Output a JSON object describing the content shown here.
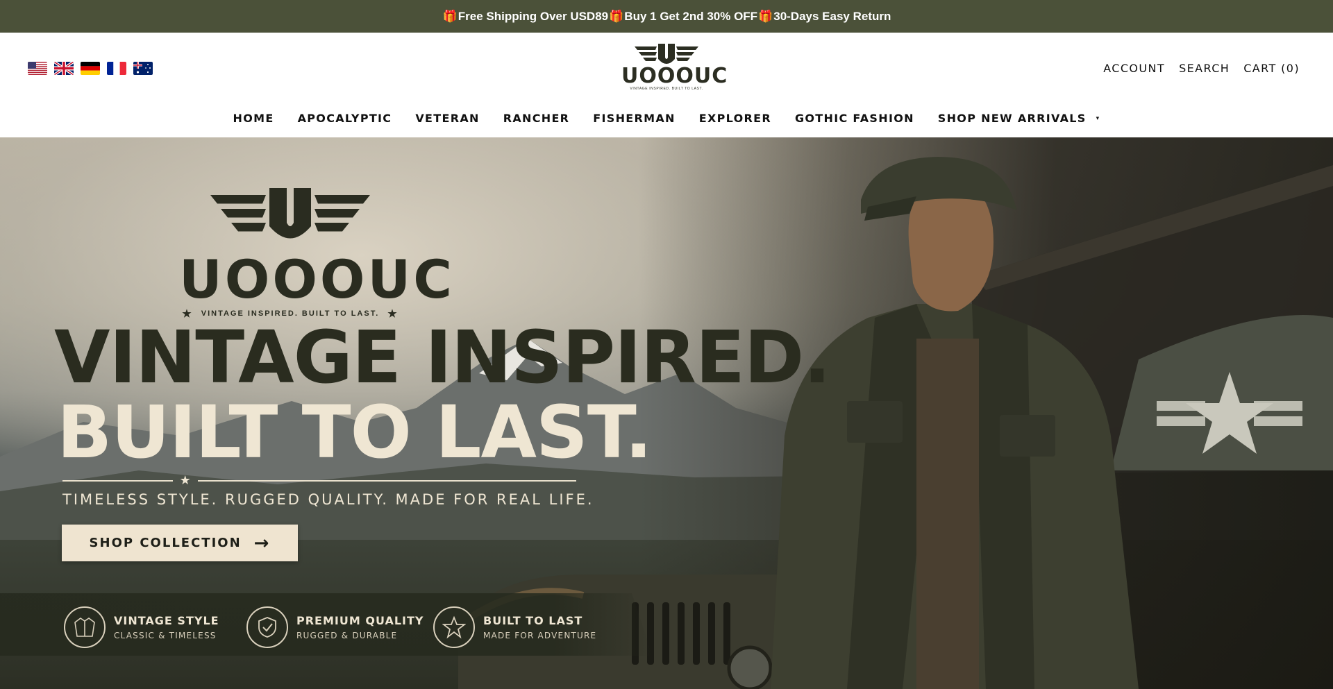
{
  "announcement": {
    "part1": "Free Shipping Over USD89",
    "part2": "Buy 1 Get 2nd 30% OFF",
    "part3": "30-Days Easy Return",
    "gift_glyph": "🎁"
  },
  "header": {
    "flags": [
      "us-flag-icon",
      "uk-flag-icon",
      "germany-flag-icon",
      "france-flag-icon",
      "australia-flag-icon"
    ],
    "logo": {
      "word": "UOOOUC",
      "tagline": "VINTAGE INSPIRED. BUILT TO LAST."
    },
    "account": "ACCOUNT",
    "search": "SEARCH",
    "cart": "CART (0)"
  },
  "nav": {
    "items": [
      "HOME",
      "APOCALYPTIC",
      "VETERAN",
      "RANCHER",
      "FISHERMAN",
      "EXPLORER",
      "GOTHIC FASHION",
      "SHOP NEW ARRIVALS"
    ],
    "caret_glyph": "▾"
  },
  "hero": {
    "logo_word": "UOOOUC",
    "logo_tag": "VINTAGE INSPIRED. BUILT TO LAST.",
    "headline_1": "VINTAGE INSPIRED.",
    "headline_2": "BUILT TO LAST.",
    "subline": "TIMELESS STYLE. RUGGED QUALITY. MADE FOR REAL LIFE.",
    "cta": "SHOP COLLECTION",
    "features": [
      {
        "title": "VINTAGE STYLE",
        "subtitle": "CLASSIC & TIMELESS",
        "icon": "jacket-icon"
      },
      {
        "title": "PREMIUM QUALITY",
        "subtitle": "RUGGED & DURABLE",
        "icon": "shield-check-icon"
      },
      {
        "title": "BUILT TO LAST",
        "subtitle": "MADE FOR ADVENTURE",
        "icon": "star-icon"
      }
    ]
  },
  "colors": {
    "announcement_bg": "#4b5139",
    "cta_bg": "#efe4d0",
    "headline_dark": "#2a2c1f",
    "headline_light": "#efe6d3"
  }
}
